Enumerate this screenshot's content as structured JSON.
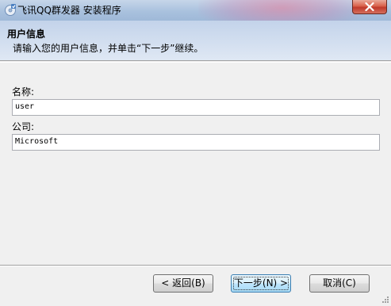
{
  "window": {
    "title": "飞讯QQ群发器 安装程序",
    "icon": "installer-cd-icon",
    "close_icon": "close-icon"
  },
  "header": {
    "title": "用户信息",
    "description": "请输入您的用户信息，并单击“下一步”继续。"
  },
  "form": {
    "name_label": "名称:",
    "name_value": "user",
    "company_label": "公司:",
    "company_value": "Microsoft"
  },
  "buttons": {
    "back": "< 返回(B)",
    "next": "下一步(N) >",
    "cancel": "取消(C)"
  },
  "colors": {
    "title_bar": "#a9c1de",
    "close_button": "#c0392b",
    "header_panel": "#c3d3ea",
    "default_button_border": "#3c7fb1"
  }
}
